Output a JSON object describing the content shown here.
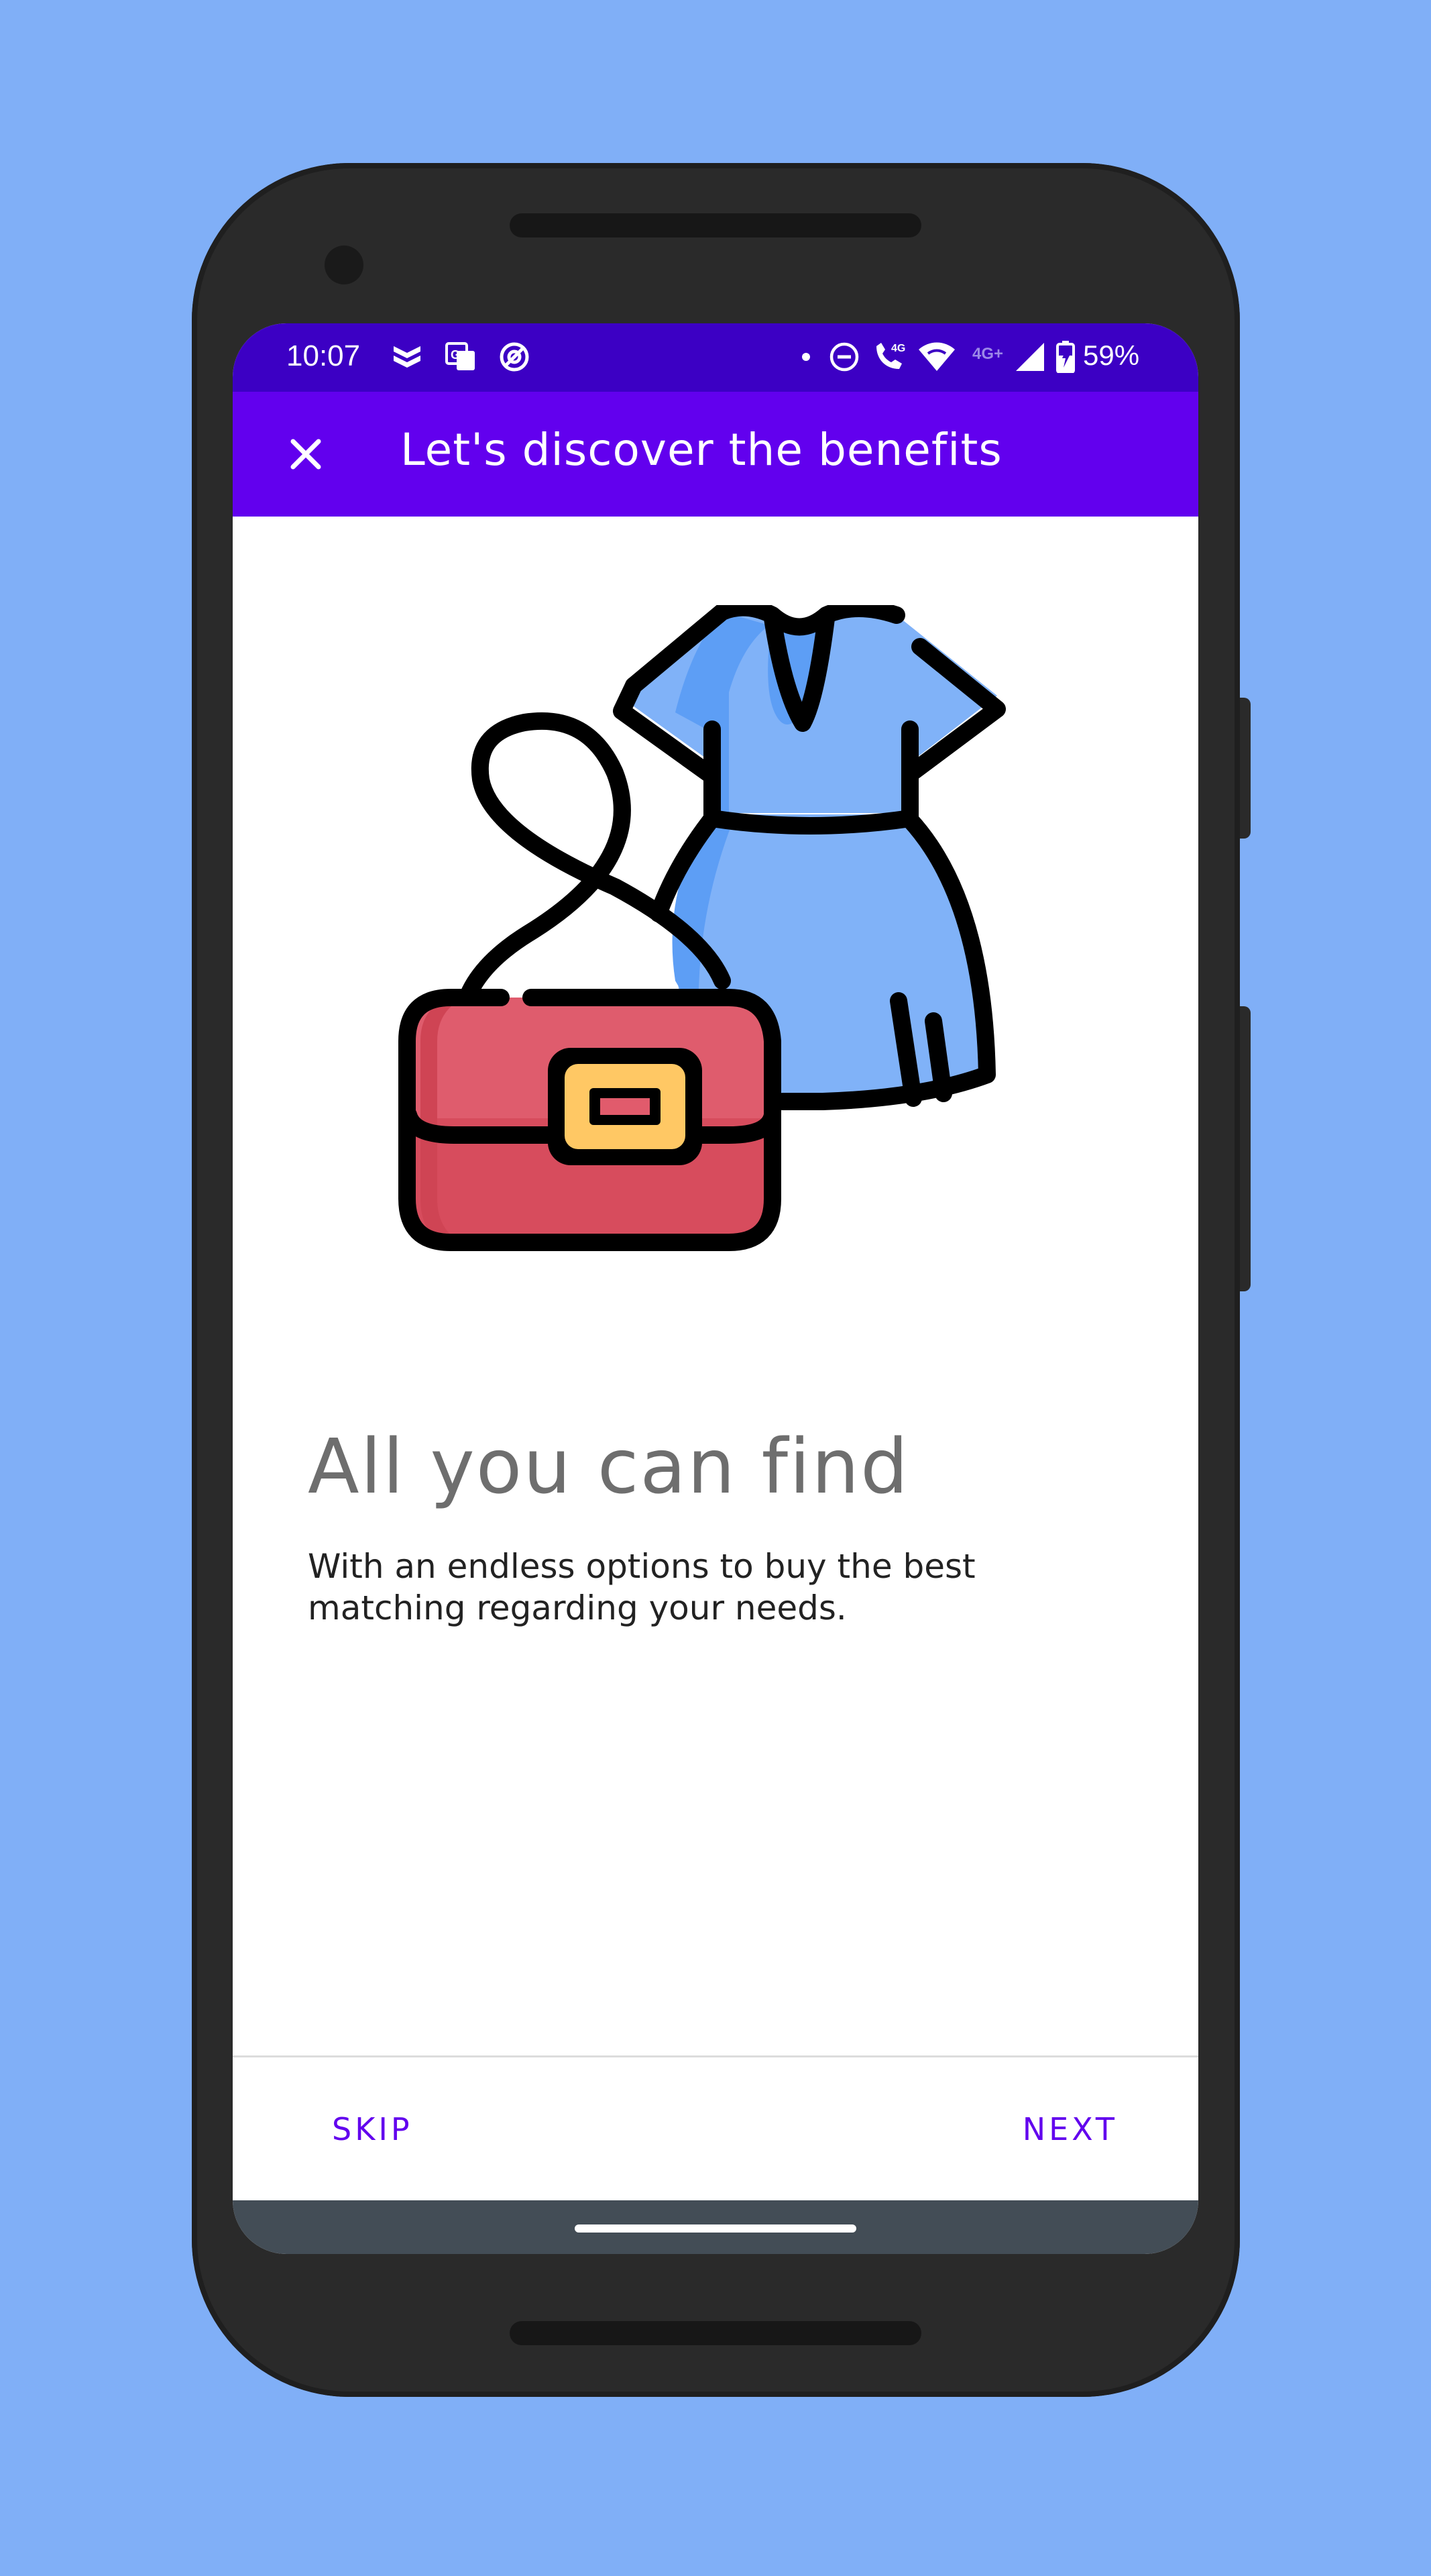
{
  "status_bar": {
    "time": "10:07",
    "battery_percent": "59%",
    "network_label": "4G",
    "network_label_faded": "4G+",
    "icons": [
      "notification-app-icon",
      "translate-icon",
      "sync-icon",
      "dot-icon",
      "dnd-icon",
      "volte-call-icon",
      "wifi-icon",
      "signal-icon",
      "battery-charging-icon"
    ]
  },
  "app_bar": {
    "title": "Let's discover the benefits",
    "close_icon": "close-icon"
  },
  "onboarding": {
    "illustration": "handbag-and-dress-illustration",
    "heading": "All you can find",
    "description": "With an endless options to buy the best matching regarding your needs."
  },
  "footer": {
    "skip_label": "SKIP",
    "next_label": "NEXT"
  },
  "colors": {
    "background": "#80aff7",
    "status_bar": "#3c00c4",
    "app_bar": "#6200ee",
    "accent": "#6200ee",
    "heading_text": "#6e6e6e",
    "nav_bar": "#434d56"
  }
}
